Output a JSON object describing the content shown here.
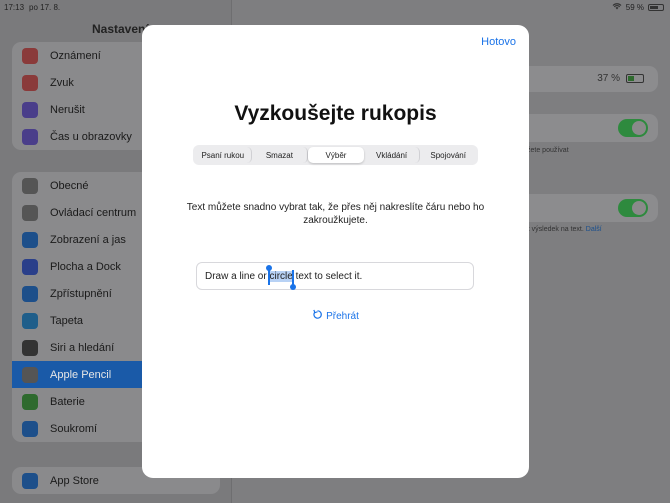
{
  "status": {
    "time": "17:13",
    "date": "po 17. 8.",
    "battery": "59 %"
  },
  "sidebar": {
    "title": "Nastavení",
    "group1": [
      {
        "label": "Oznámení",
        "icon": "notifications-icon",
        "color": "#8a3a3a"
      },
      {
        "label": "Zvuk",
        "icon": "sound-icon",
        "color": "#8a3a3a"
      },
      {
        "label": "Nerušit",
        "icon": "moon-icon",
        "color": "#4a3e8a"
      },
      {
        "label": "Čas u obrazovky",
        "icon": "hourglass-icon",
        "color": "#4a3e8a"
      }
    ],
    "group2": [
      {
        "label": "Obecné",
        "icon": "gear-icon",
        "color": "#555"
      },
      {
        "label": "Ovládací centrum",
        "icon": "toggles-icon",
        "color": "#555"
      },
      {
        "label": "Zobrazení a jas",
        "icon": "text-size-icon",
        "color": "#1d4f8a"
      },
      {
        "label": "Plocha a Dock",
        "icon": "grid-icon",
        "color": "#2a3f8a"
      },
      {
        "label": "Zpřístupnění",
        "icon": "accessibility-icon",
        "color": "#1d4f8a"
      },
      {
        "label": "Tapeta",
        "icon": "flower-icon",
        "color": "#1f5e8a"
      },
      {
        "label": "Siri a hledání",
        "icon": "siri-icon",
        "color": "#333"
      },
      {
        "label": "Apple Pencil",
        "icon": "pencil-icon",
        "color": "#555"
      },
      {
        "label": "Baterie",
        "icon": "battery-icon",
        "color": "#2e6a2e"
      },
      {
        "label": "Soukromí",
        "icon": "hand-icon",
        "color": "#1d4f8a"
      }
    ],
    "group3": [
      {
        "label": "App Store",
        "icon": "app-store-icon",
        "color": "#1d4f8a"
      }
    ],
    "active": "Apple Pencil"
  },
  "detail": {
    "battery_value": "37 %",
    "note1": "r můžete používat",
    "note2": "evést výsledek na text.",
    "note2_link": "Další"
  },
  "modal": {
    "done_label": "Hotovo",
    "title": "Vyzkoušejte rukopis",
    "segments": [
      "Psaní rukou",
      "Smazat",
      "Výběr",
      "Vkládání",
      "Spojování"
    ],
    "selected_segment": "Výběr",
    "description": "Text můžete snadno vybrat tak, že přes něj nakreslíte čáru nebo ho zakroužkujete.",
    "demo": {
      "before": "Draw a line or ",
      "highlight": "circle",
      "after": " text to select it."
    },
    "replay_label": "Přehrát"
  },
  "colors": {
    "accent": "#1a73e8",
    "toggle_on": "#34c759",
    "selection": "#b8d2f5"
  }
}
